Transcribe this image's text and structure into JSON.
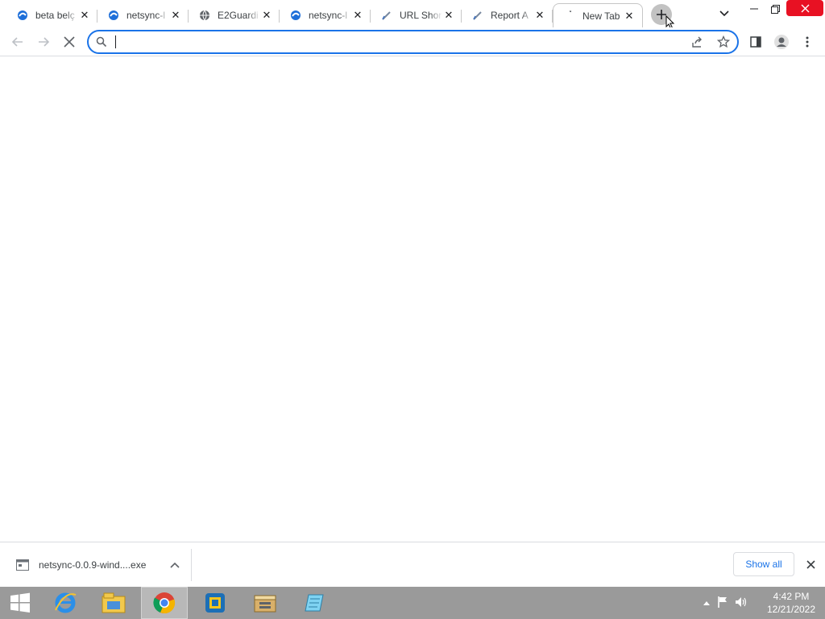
{
  "browser": {
    "tabs": [
      {
        "title": "beta belç",
        "favicon": "edge-blue-icon",
        "active": false
      },
      {
        "title": "netsync-l",
        "favicon": "edge-blue-icon",
        "active": false
      },
      {
        "title": "E2Guardi",
        "favicon": "globe-icon",
        "active": false
      },
      {
        "title": "netsync-l",
        "favicon": "edge-blue-icon",
        "active": false
      },
      {
        "title": "URL Shor",
        "favicon": "pen-icon",
        "active": false
      },
      {
        "title": "Report A",
        "favicon": "pen-icon",
        "active": false
      },
      {
        "title": "New Tab",
        "favicon": "loading-icon",
        "active": true
      }
    ],
    "omnibox": {
      "value": "",
      "placeholder": ""
    },
    "accent": "#1a73e8"
  },
  "downloads": {
    "file_name": "netsync-0.0.9-wind....exe",
    "show_all_label": "Show all"
  },
  "taskbar": {
    "apps": [
      "internet-explorer-icon",
      "file-explorer-icon",
      "chrome-icon",
      "virtualbox-icon",
      "archive-icon",
      "notepad-icon"
    ],
    "time": "4:42 PM",
    "date": "12/21/2022"
  }
}
